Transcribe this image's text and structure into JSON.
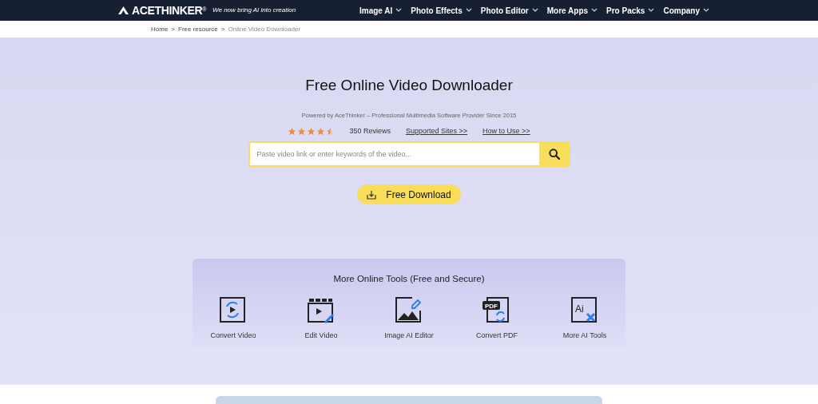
{
  "header": {
    "logo": "ACETHINKER",
    "logo_mark": "®",
    "tagline": "We now bring AI into creation",
    "nav": [
      {
        "label": "Image AI"
      },
      {
        "label": "Photo Effects"
      },
      {
        "label": "Photo Editor"
      },
      {
        "label": "More Apps"
      },
      {
        "label": "Pro Packs"
      },
      {
        "label": "Company"
      }
    ]
  },
  "breadcrumb": {
    "separator": ">",
    "items": [
      "Home",
      "Free resource",
      "Online Video Downloader"
    ]
  },
  "hero": {
    "title": "Free Online Video Downloader",
    "subtitle": "Powered by AceThinker – Professional Multimedia Software Provider Since 2015",
    "stars": 4.5,
    "reviews": "350 Reviews",
    "links": [
      "Supported Sites >>",
      "How to Use >>"
    ],
    "search": {
      "placeholder": "Paste video link or enter keywords of the video..."
    },
    "download_button": "Free Download"
  },
  "tools": {
    "title": "More Online Tools (Free and Secure)",
    "items": [
      {
        "kind": "convert-video",
        "label": "Convert Video"
      },
      {
        "kind": "edit-video",
        "label": "Edit Video"
      },
      {
        "kind": "image-ai",
        "label": "Image AI Editor"
      },
      {
        "kind": "pdf",
        "label": "Convert PDF",
        "icon_text": "PDF"
      },
      {
        "kind": "ai",
        "label": "More AI Tools",
        "icon_text": "Ai"
      }
    ]
  }
}
